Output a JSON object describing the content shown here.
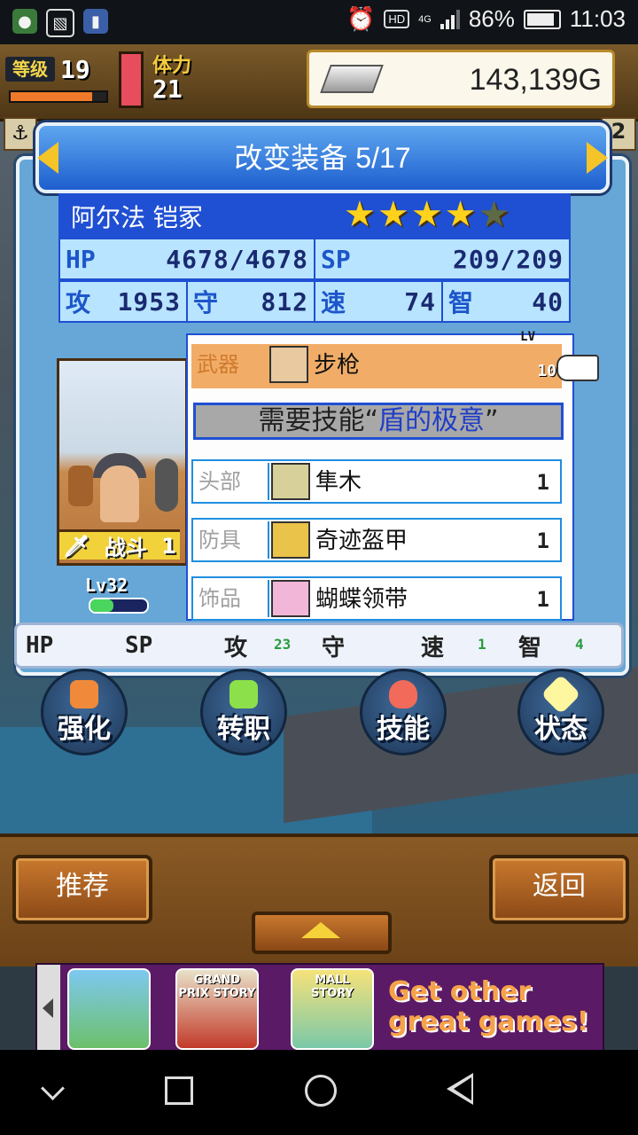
{
  "statusbar": {
    "hd": "HD",
    "net": "4G",
    "battery": "86%",
    "time": "11:03"
  },
  "hud": {
    "level_label": "等级",
    "level": "19",
    "stamina_label": "体力",
    "stamina": "21",
    "gold": "143,139G",
    "side_num": "2"
  },
  "panel": {
    "title": "改变装备 5/17"
  },
  "character": {
    "name": "阿尔法 铠冢",
    "stars": 4,
    "max_stars": 5,
    "hp_label": "HP",
    "hp": "4678/4678",
    "sp_label": "SP",
    "sp": "209/209",
    "atk_label": "攻",
    "atk": "1953",
    "def_label": "守",
    "def": "812",
    "spd_label": "速",
    "spd": "74",
    "int_label": "智",
    "int": "40",
    "battle_label": "战斗",
    "battle_num": "1",
    "level": "Lv32"
  },
  "equipment": {
    "weapon": {
      "slot": "武器",
      "name": "步枪",
      "lv_label": "LV",
      "lv": "10"
    },
    "requirement": {
      "prefix": "需要技能“",
      "skill": "盾的极意",
      "suffix": "”"
    },
    "head": {
      "slot": "头部",
      "name": "隼木",
      "count": "1"
    },
    "armor": {
      "slot": "防具",
      "name": "奇迹盔甲",
      "count": "1"
    },
    "accessory": {
      "slot": "饰品",
      "name": "蝴蝶领带",
      "count": "1"
    }
  },
  "delta": {
    "hp": "HP",
    "sp": "SP",
    "atk": "攻",
    "atk_val": "23",
    "def": "守",
    "spd": "速",
    "spd_val": "1",
    "int": "智",
    "int_val": "4"
  },
  "actions": [
    "强化",
    "转职",
    "技能",
    "状态"
  ],
  "buttons": {
    "recommend": "推荐",
    "back": "返回"
  },
  "ad": {
    "games": [
      "",
      "GRAND PRIX STORY",
      "MALL STORY"
    ],
    "text": "Get other great games!"
  }
}
